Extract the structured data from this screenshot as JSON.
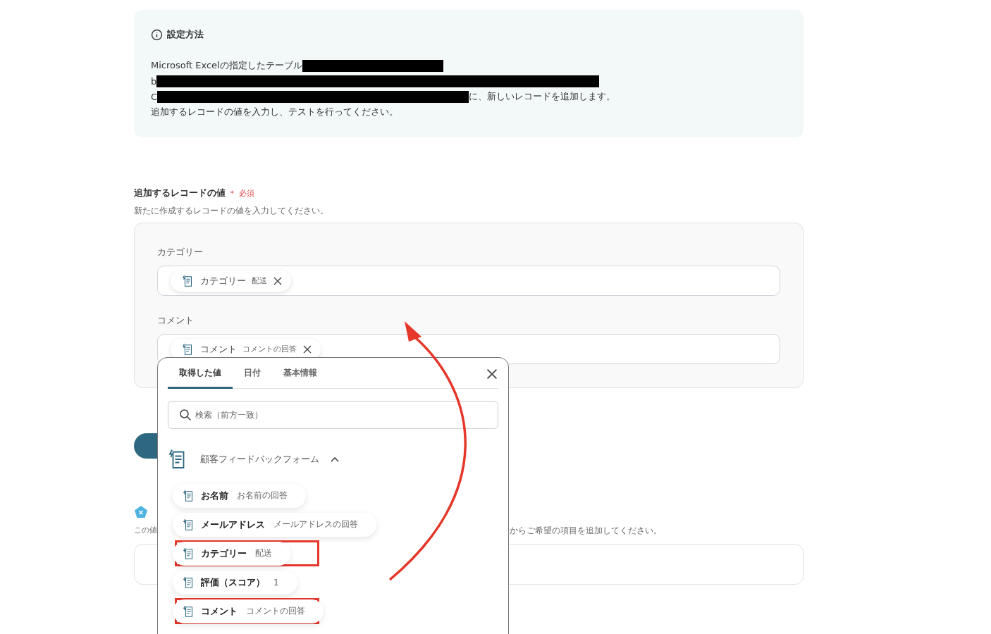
{
  "info": {
    "title": "設定方法",
    "lines": [
      [
        {
          "kind": "text",
          "text": "Microsoft Excelの指定したテーブル"
        },
        {
          "kind": "redacted"
        }
      ],
      [
        {
          "kind": "text",
          "text": "b"
        },
        {
          "kind": "redacted"
        }
      ],
      [
        {
          "kind": "text",
          "text": "C"
        },
        {
          "kind": "redacted"
        },
        {
          "kind": "text",
          "text": "に、新しいレコードを追加します。"
        }
      ],
      [
        {
          "kind": "text",
          "text": "追加するレコードの値を入力し、テストを行ってください。"
        }
      ]
    ]
  },
  "record": {
    "label": "追加するレコードの値",
    "required_mark": "＊",
    "required": "必須",
    "hint": "新たに作成するレコードの値を入力してください。",
    "fields": [
      {
        "label": "カテゴリー",
        "chips": [
          {
            "name": "カテゴリー",
            "value": "配送"
          }
        ]
      },
      {
        "label": "コメント",
        "chips": [
          {
            "name": "コメント",
            "value": "コメントの回答"
          }
        ]
      }
    ]
  },
  "second": {
    "hint_left": "この値",
    "hint_right": "からご希望の項目を追加してください。"
  },
  "popup": {
    "tabs": [
      {
        "label": "取得した値",
        "selected": true
      },
      {
        "label": "日付",
        "selected": false
      },
      {
        "label": "基本情報",
        "selected": false
      }
    ],
    "search": {
      "placeholder": "検索（前方一致）"
    },
    "group": {
      "title": "顧客フィードバックフォーム",
      "expanded": true,
      "items": [
        {
          "name": "お名前",
          "value": "お名前の回答",
          "highlighted": false
        },
        {
          "name": "メールアドレス",
          "value": "メールアドレスの回答",
          "highlighted": false
        },
        {
          "name": "カテゴリー",
          "value": "配送",
          "highlighted": true
        },
        {
          "name": "評価（スコア）",
          "value": "1",
          "highlighted": false
        },
        {
          "name": "コメント",
          "value": "コメントの回答",
          "highlighted": true
        }
      ]
    }
  }
}
